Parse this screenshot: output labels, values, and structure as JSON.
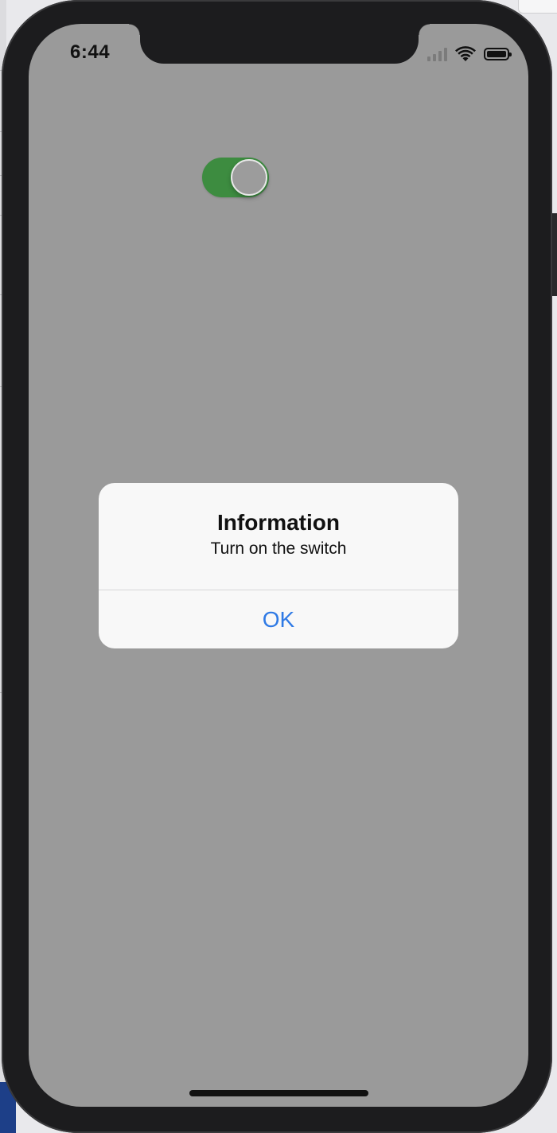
{
  "status_bar": {
    "time": "6:44",
    "icons": [
      "cellular-signal-icon",
      "wifi-icon",
      "battery-icon"
    ]
  },
  "toggle": {
    "state": "on",
    "color": "#3d8c40"
  },
  "alert": {
    "title": "Information",
    "message": "Turn on the switch",
    "button_label": "OK",
    "button_color": "#2f7ae5"
  },
  "colors": {
    "dimmed_background": "#9a9a9a",
    "bezel": "#1c1c1e"
  }
}
